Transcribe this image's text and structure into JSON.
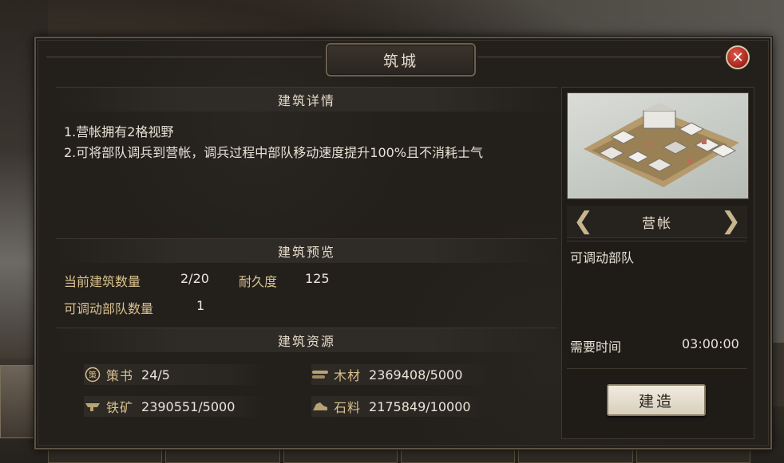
{
  "dialog": {
    "title": "筑城",
    "close_label": "✕"
  },
  "details": {
    "section_title": "建筑详情",
    "lines": [
      "1.营帐拥有2格视野",
      "2.可将部队调兵到营帐，调兵过程中部队移动速度提升100%且不消耗士气"
    ]
  },
  "preview_section": {
    "section_title": "建筑预览",
    "current_count_label": "当前建筑数量",
    "current_count_value": "2/20",
    "durability_label": "耐久度",
    "durability_value": "125",
    "deployable_label": "可调动部队数量",
    "deployable_value": "1"
  },
  "resources": {
    "section_title": "建筑资源",
    "items": [
      {
        "icon": "strategy-book-icon",
        "label": "策书",
        "value": "24/5"
      },
      {
        "icon": "wood-icon",
        "label": "木材",
        "value": "2369408/5000"
      },
      {
        "icon": "iron-icon",
        "label": "铁矿",
        "value": "2390551/5000"
      },
      {
        "icon": "stone-icon",
        "label": "石料",
        "value": "2175849/10000"
      }
    ]
  },
  "side_panel": {
    "building_name": "营帐",
    "building_desc": "可调动部队",
    "time_label": "需要时间",
    "time_value": "03:00:00",
    "build_label": "建造"
  },
  "colors": {
    "gold_text": "#d9c08e",
    "close_red": "#b3281e"
  }
}
